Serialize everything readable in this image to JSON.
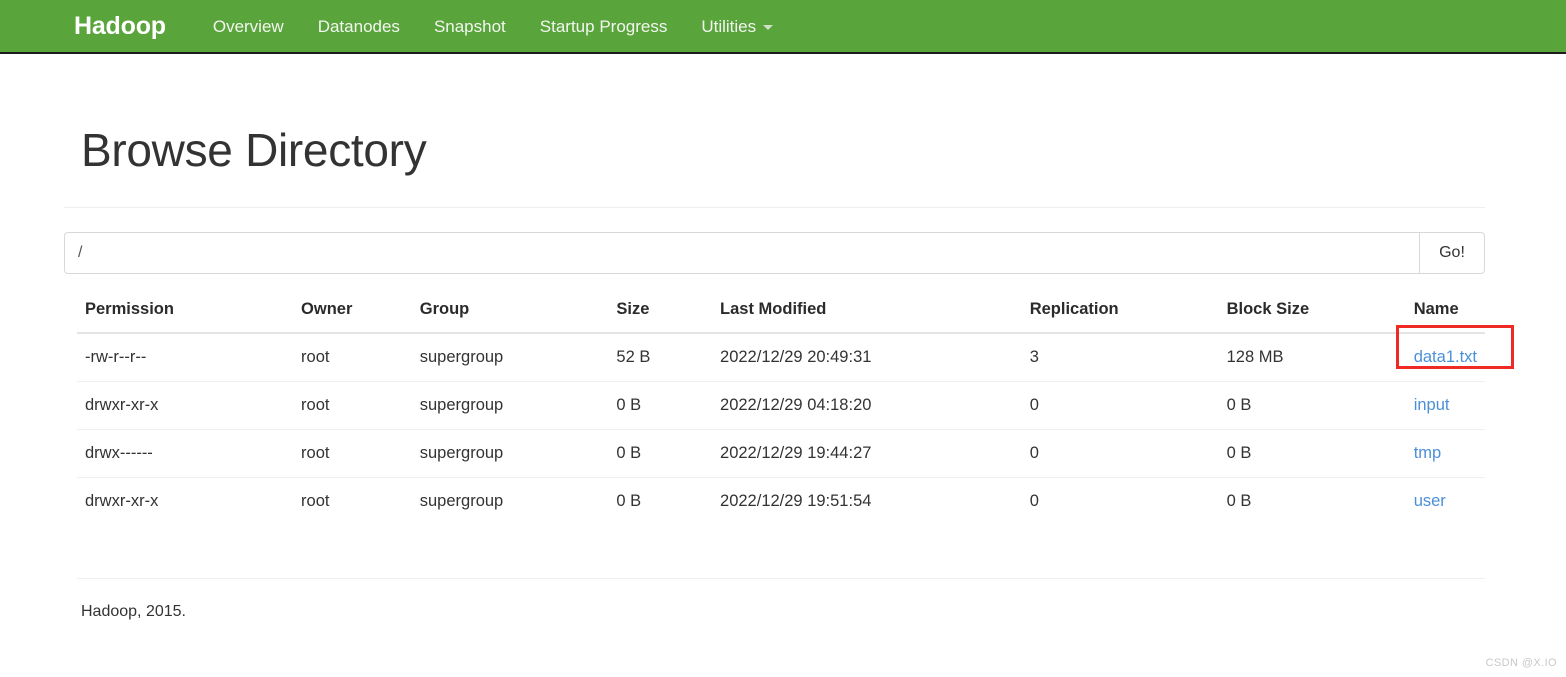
{
  "navbar": {
    "brand": "Hadoop",
    "links": [
      {
        "label": "Overview",
        "has_caret": false
      },
      {
        "label": "Datanodes",
        "has_caret": false
      },
      {
        "label": "Snapshot",
        "has_caret": false
      },
      {
        "label": "Startup Progress",
        "has_caret": false
      },
      {
        "label": "Utilities",
        "has_caret": true
      }
    ],
    "background_color": "#5aa43c"
  },
  "page": {
    "title": "Browse Directory"
  },
  "path_bar": {
    "value": "/",
    "placeholder": "/",
    "go_label": "Go!"
  },
  "table": {
    "headers": [
      "Permission",
      "Owner",
      "Group",
      "Size",
      "Last Modified",
      "Replication",
      "Block Size",
      "Name"
    ],
    "rows": [
      {
        "permission": "-rw-r--r--",
        "owner": "root",
        "group": "supergroup",
        "size": "52 B",
        "last_modified": "2022/12/29 20:49:31",
        "replication": "3",
        "block_size": "128 MB",
        "name": "data1.txt",
        "highlighted": true
      },
      {
        "permission": "drwxr-xr-x",
        "owner": "root",
        "group": "supergroup",
        "size": "0 B",
        "last_modified": "2022/12/29 04:18:20",
        "replication": "0",
        "block_size": "0 B",
        "name": "input",
        "highlighted": false
      },
      {
        "permission": "drwx------",
        "owner": "root",
        "group": "supergroup",
        "size": "0 B",
        "last_modified": "2022/12/29 19:44:27",
        "replication": "0",
        "block_size": "0 B",
        "name": "tmp",
        "highlighted": false
      },
      {
        "permission": "drwxr-xr-x",
        "owner": "root",
        "group": "supergroup",
        "size": "0 B",
        "last_modified": "2022/12/29 19:51:54",
        "replication": "0",
        "block_size": "0 B",
        "name": "user",
        "highlighted": false
      }
    ]
  },
  "footer": {
    "text": "Hadoop, 2015."
  },
  "watermark": {
    "text": "CSDN @X.IO"
  },
  "colors": {
    "brand_green": "#5aa43c",
    "link_blue": "#4a90d9",
    "highlight_red": "#ef2a24"
  }
}
